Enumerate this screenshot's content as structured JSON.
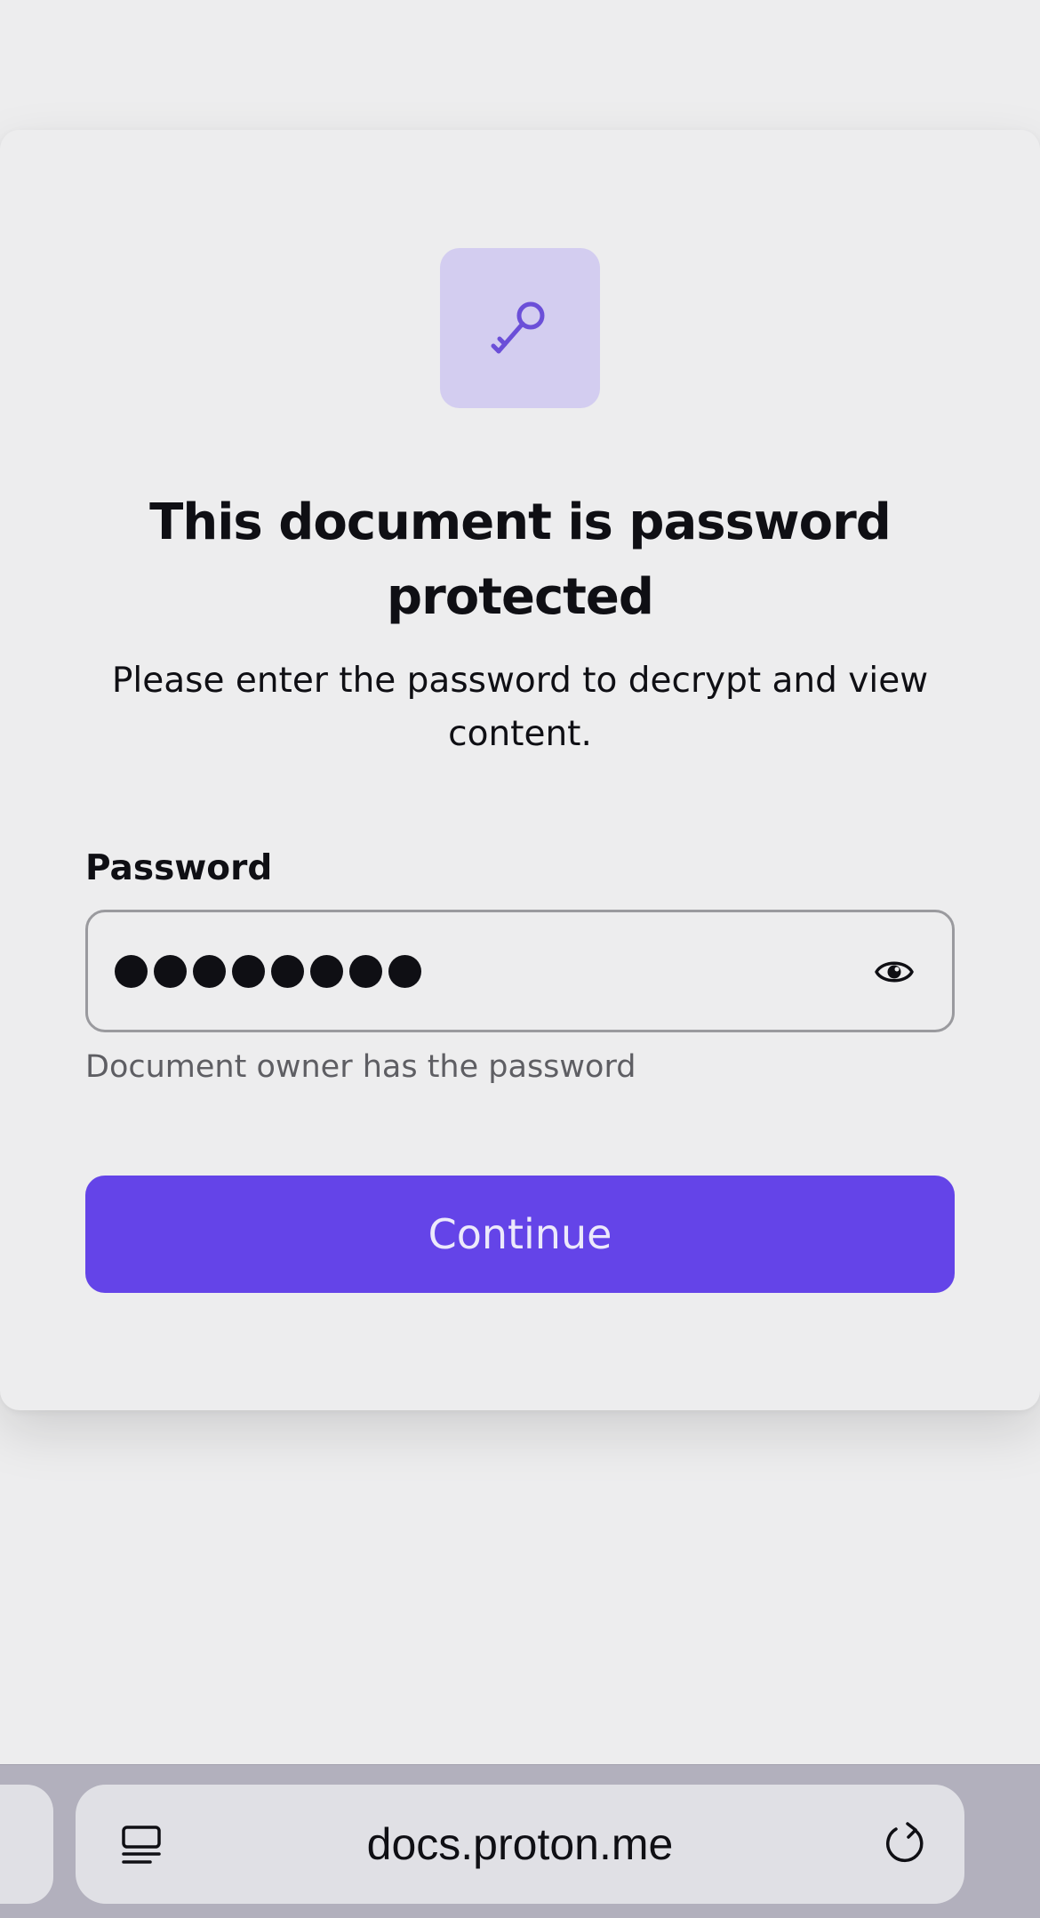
{
  "dialog": {
    "icon": "key-icon",
    "title": "This document is password protected",
    "subtitle": "Please enter the password to decrypt and view content.",
    "password_label": "Password",
    "password_masked_length": 8,
    "toggle_icon": "eye-icon",
    "hint": "Document owner has the password",
    "continue_label": "Continue"
  },
  "browser": {
    "url": "docs.proton.me",
    "left_icon": "reader-mode-icon",
    "right_icon": "reload-icon"
  },
  "colors": {
    "accent": "#6444e8",
    "icon_tile": "#d3cdf0",
    "key_icon": "#6b4fd8",
    "background": "#ededee"
  }
}
